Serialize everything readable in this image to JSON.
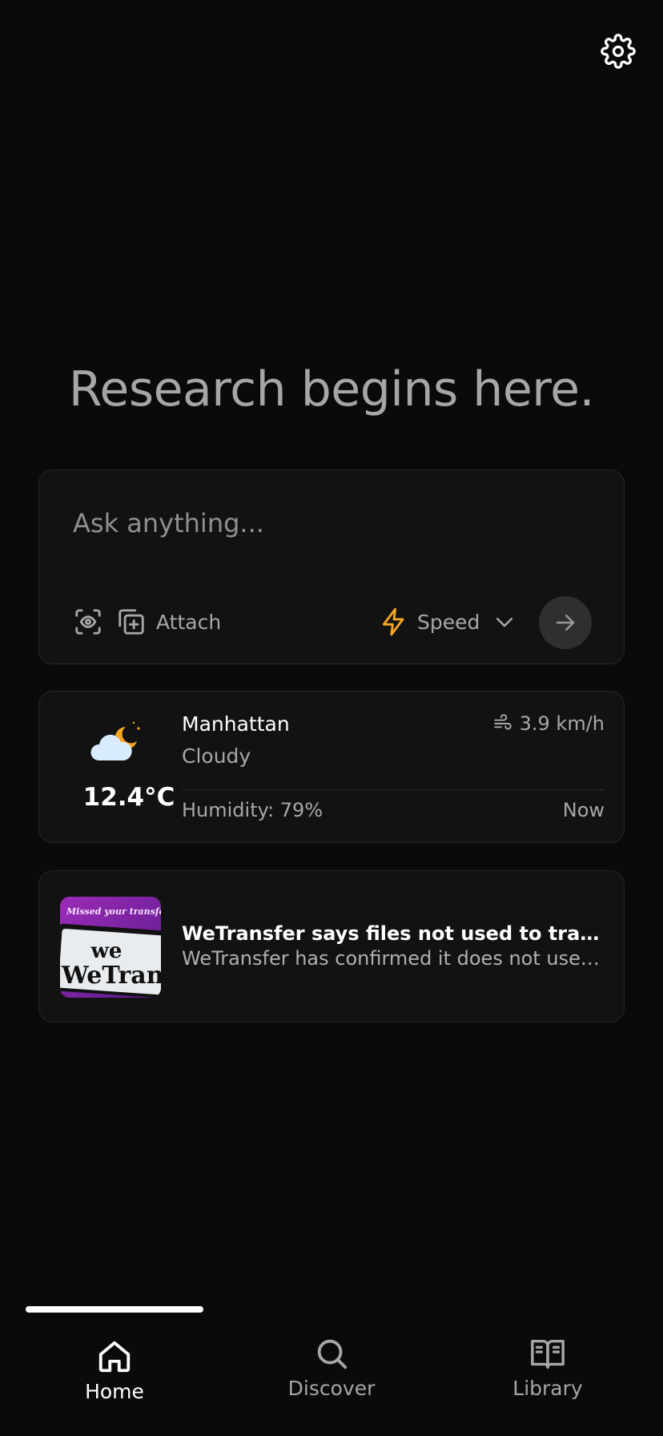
{
  "header": {
    "settings_icon": "gear-icon"
  },
  "hero": {
    "headline": "Research begins here."
  },
  "ask": {
    "placeholder": "Ask anything...",
    "attach_label": "Attach",
    "mode_label": "Speed",
    "mode_color": "#f5a623"
  },
  "weather": {
    "location": "Manhattan",
    "condition": "Cloudy",
    "temperature": "12.4°C",
    "wind": "3.9 km/h",
    "humidity": "Humidity: 79%",
    "time": "Now",
    "icon": "partly-cloudy-night-icon"
  },
  "news": {
    "title": "WeTransfer says files not used to train AI",
    "summary": "WeTransfer has confirmed it does not use customer files to train AI",
    "thumbnail": {
      "banner_text": "Missed your transfer?",
      "logo_short": "we",
      "logo_text": "WeTransfer"
    }
  },
  "nav": {
    "items": [
      {
        "label": "Home",
        "icon": "home-icon",
        "active": true
      },
      {
        "label": "Discover",
        "icon": "search-icon",
        "active": false
      },
      {
        "label": "Library",
        "icon": "book-icon",
        "active": false
      }
    ]
  }
}
